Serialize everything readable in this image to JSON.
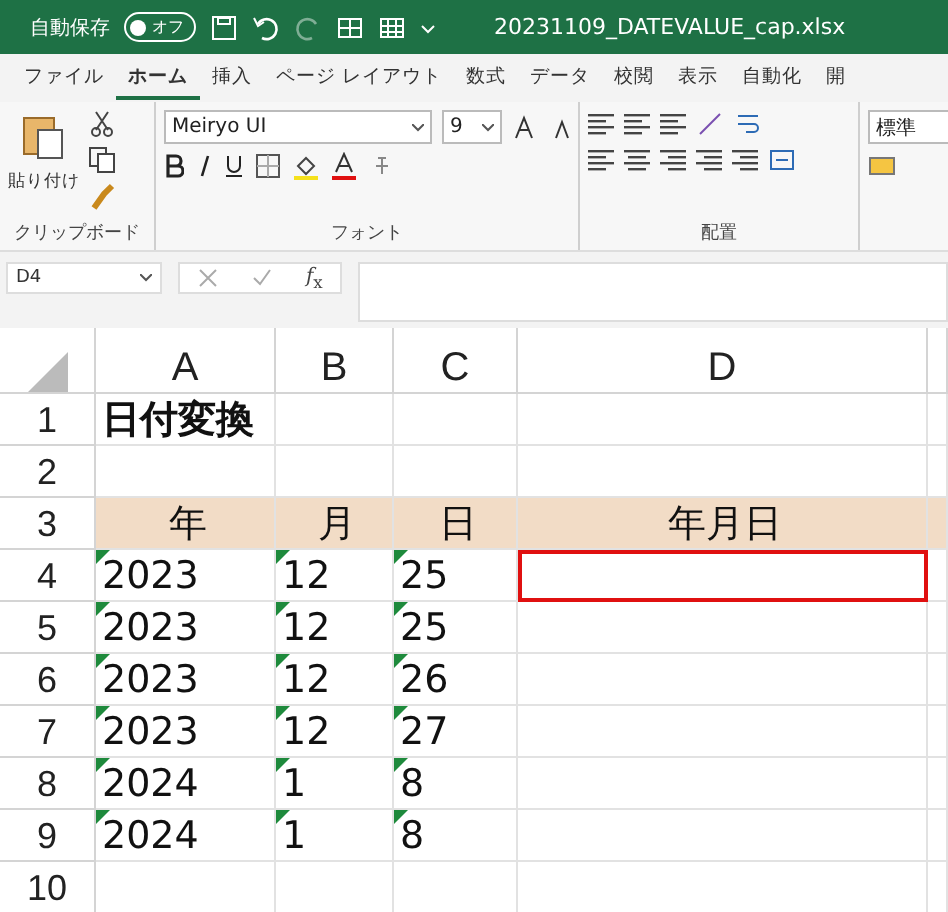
{
  "title_bar": {
    "autosave_label": "自動保存",
    "autosave_toggle": {
      "label": "オフ",
      "on": false
    },
    "filename": "20231109_DATEVALUE_cap.xlsx"
  },
  "ribbon_tabs": [
    {
      "label": "ファイル",
      "selected": false
    },
    {
      "label": "ホーム",
      "selected": true
    },
    {
      "label": "挿入",
      "selected": false
    },
    {
      "label": "ページ レイアウト",
      "selected": false
    },
    {
      "label": "数式",
      "selected": false
    },
    {
      "label": "データ",
      "selected": false
    },
    {
      "label": "校閲",
      "selected": false
    },
    {
      "label": "表示",
      "selected": false
    },
    {
      "label": "自動化",
      "selected": false
    },
    {
      "label": "開",
      "selected": false
    }
  ],
  "ribbon": {
    "clipboard": {
      "paste_label": "貼り付け",
      "group_label": "クリップボード"
    },
    "font": {
      "font_name": "Meiryo UI",
      "font_size": "9",
      "group_label": "フォント"
    },
    "alignment": {
      "group_label": "配置"
    },
    "number": {
      "format": "標準"
    }
  },
  "formula_bar": {
    "name_box": "D4",
    "fx": "*f*$_{x}$"
  },
  "sheet": {
    "columns": [
      "A",
      "B",
      "C",
      "D"
    ],
    "rows": [
      {
        "header": "1",
        "kind": "title",
        "cells": [
          {
            "text": "日付変換",
            "flag": false,
            "selected": false
          },
          {
            "flag": false,
            "selected": false
          },
          {
            "flag": false,
            "selected": false
          },
          {
            "flag": false,
            "selected": false
          }
        ]
      },
      {
        "header": "2",
        "kind": "data",
        "cells": [
          {
            "flag": false,
            "selected": false
          },
          {
            "flag": false,
            "selected": false
          },
          {
            "flag": false,
            "selected": false
          },
          {
            "flag": false,
            "selected": false
          }
        ]
      },
      {
        "header": "3",
        "kind": "header",
        "cells": [
          {
            "text": "年",
            "flag": false,
            "selected": false
          },
          {
            "text": "月",
            "flag": false,
            "selected": false
          },
          {
            "text": "日",
            "flag": false,
            "selected": false
          },
          {
            "text": "年月日",
            "flag": false,
            "selected": false
          }
        ]
      },
      {
        "header": "4",
        "kind": "data",
        "cells": [
          {
            "text": "2023",
            "flag": true,
            "selected": false
          },
          {
            "text": "12",
            "flag": true,
            "selected": false
          },
          {
            "text": "25",
            "flag": true,
            "selected": false
          },
          {
            "flag": false,
            "selected": true
          }
        ]
      },
      {
        "header": "5",
        "kind": "data",
        "cells": [
          {
            "text": "2023",
            "flag": true,
            "selected": false
          },
          {
            "text": "12",
            "flag": true,
            "selected": false
          },
          {
            "text": "25",
            "flag": true,
            "selected": false
          },
          {
            "flag": false,
            "selected": false
          }
        ]
      },
      {
        "header": "6",
        "kind": "data",
        "cells": [
          {
            "text": "2023",
            "flag": true,
            "selected": false
          },
          {
            "text": "12",
            "flag": true,
            "selected": false
          },
          {
            "text": "26",
            "flag": true,
            "selected": false
          },
          {
            "flag": false,
            "selected": false
          }
        ]
      },
      {
        "header": "7",
        "kind": "data",
        "cells": [
          {
            "text": "2023",
            "flag": true,
            "selected": false
          },
          {
            "text": "12",
            "flag": true,
            "selected": false
          },
          {
            "text": "27",
            "flag": true,
            "selected": false
          },
          {
            "flag": false,
            "selected": false
          }
        ]
      },
      {
        "header": "8",
        "kind": "data",
        "cells": [
          {
            "text": "2024",
            "flag": true,
            "selected": false
          },
          {
            "text": "1",
            "flag": true,
            "selected": false
          },
          {
            "text": "8",
            "flag": true,
            "selected": false
          },
          {
            "flag": false,
            "selected": false
          }
        ]
      },
      {
        "header": "9",
        "kind": "data",
        "cells": [
          {
            "text": "2024",
            "flag": true,
            "selected": false
          },
          {
            "text": "1",
            "flag": true,
            "selected": false
          },
          {
            "text": "8",
            "flag": true,
            "selected": false
          },
          {
            "flag": false,
            "selected": false
          }
        ]
      },
      {
        "header": "10",
        "kind": "data",
        "cells": [
          {
            "flag": false,
            "selected": false
          },
          {
            "flag": false,
            "selected": false
          },
          {
            "flag": false,
            "selected": false
          },
          {
            "flag": false,
            "selected": false
          }
        ]
      }
    ]
  }
}
